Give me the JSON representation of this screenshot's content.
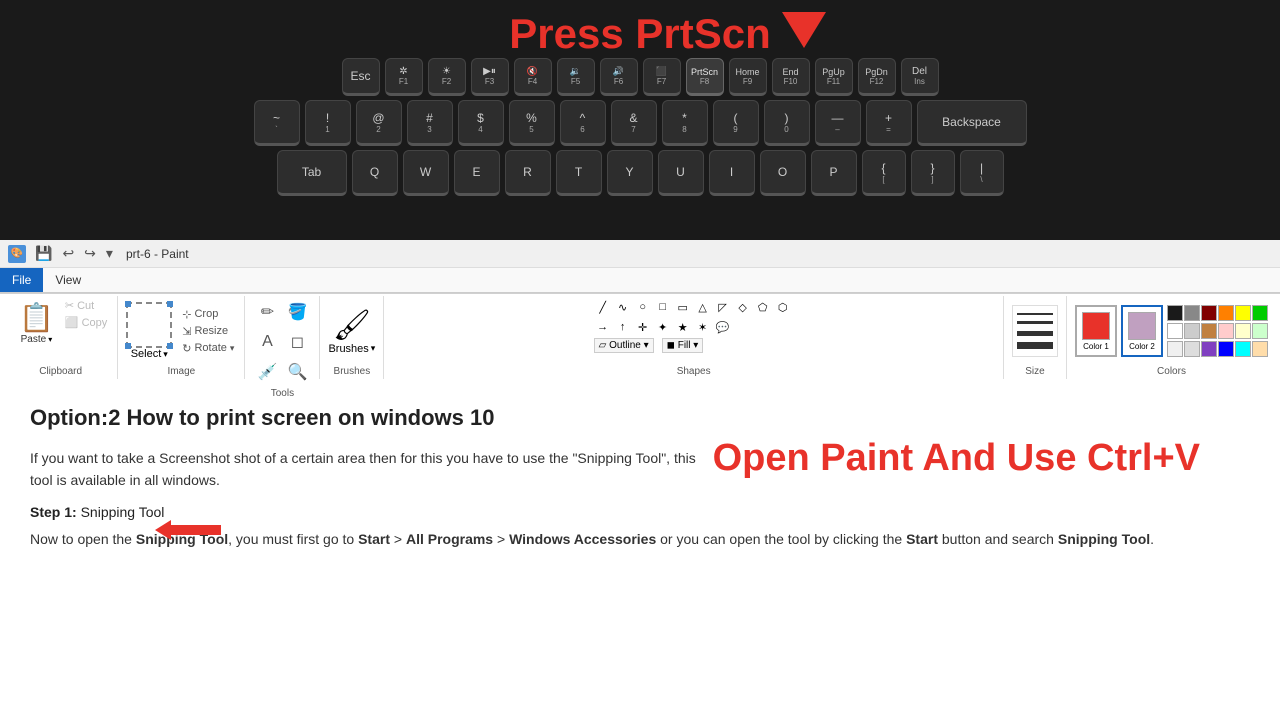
{
  "keyboard": {
    "press_label": "Press PrtScn",
    "rows": [
      {
        "keys": [
          {
            "label": "Esc",
            "sub": "",
            "width": "fn"
          },
          {
            "label": "✲",
            "sub": "F1",
            "width": "fn"
          },
          {
            "label": "☀",
            "sub": "F2",
            "width": "fn"
          },
          {
            "label": "▶⏸",
            "sub": "F3",
            "width": "fn"
          },
          {
            "label": "🔇",
            "sub": "F4",
            "width": "fn"
          },
          {
            "label": "🔉",
            "sub": "F5",
            "width": "fn"
          },
          {
            "label": "🔊",
            "sub": "F6",
            "width": "fn"
          },
          {
            "label": "⬛",
            "sub": "F7",
            "width": "fn"
          },
          {
            "label": "PrtScn",
            "sub": "F8",
            "width": "fn",
            "highlight": true
          },
          {
            "label": "Home",
            "sub": "F9",
            "width": "fn"
          },
          {
            "label": "End",
            "sub": "F10",
            "width": "fn"
          },
          {
            "label": "PgUp",
            "sub": "F11",
            "width": "fn"
          },
          {
            "label": "PgDn",
            "sub": "F12",
            "width": "fn"
          },
          {
            "label": "Del",
            "sub": "Ins",
            "width": "fn"
          }
        ]
      }
    ],
    "row2": [
      "~`",
      "!1",
      "@2",
      "#3",
      "$4",
      "%5",
      "^6",
      "&7",
      "*8",
      "(9",
      ")0",
      "—–",
      "+=",
      "Backspace"
    ],
    "row3": [
      "Tab",
      "Q",
      "W",
      "E",
      "R",
      "T",
      "Y",
      "U",
      "I",
      "O",
      "P",
      "{[",
      "}]",
      "|\\"
    ]
  },
  "paint": {
    "title": "prt-6 - Paint",
    "tabs": {
      "file": "File",
      "view": "View"
    },
    "groups": {
      "clipboard": {
        "label": "Clipboard",
        "paste": "Paste",
        "cut": "Cut",
        "copy": "Copy"
      },
      "image": {
        "label": "Image",
        "select": "Select",
        "crop": "Crop",
        "resize": "Resize",
        "rotate": "Rotate"
      },
      "tools": {
        "label": "Tools"
      },
      "brushes": {
        "label": "Brushes",
        "btn": "Brushes"
      },
      "shapes": {
        "label": "Shapes",
        "outline": "Outline ▾",
        "fill": "Fill ▾"
      },
      "size": {
        "label": "Size",
        "btn": "Size"
      },
      "colors": {
        "label": "Colors",
        "color1": "Color\n1",
        "color2": "Color\n2"
      }
    }
  },
  "content": {
    "title": "Option:2 How to print screen on windows 10",
    "body": "If you want to take a Screenshot shot of a certain area then for this you have to use the \"Snipping Tool\", this tool is available in all windows.",
    "step1_label": "Step 1:",
    "step1_tool": "Snipping Tool",
    "overlay_text": "Open Paint And Use Ctrl+V",
    "step1_body_start": "Now to open the ",
    "step1_body_tool": "Snipping Tool",
    "step1_body_mid": ", you must first go to ",
    "step1_body_start2": "Start",
    "step1_body_gt": " > ",
    "step1_body_all": "All Programs",
    "step1_body_gt2": " > ",
    "step1_body_wa": "Windows Accessories",
    "step1_body_or": " or you can open the tool by clicking the ",
    "step1_body_start3": "Start",
    "step1_body_end": " button and search ",
    "step1_body_st": "Snipping Tool",
    "step1_body_period": "."
  }
}
